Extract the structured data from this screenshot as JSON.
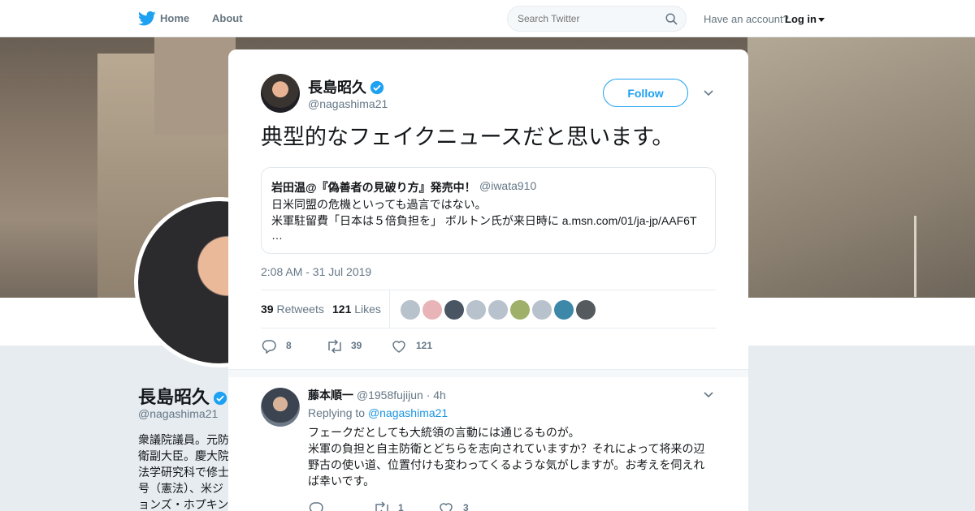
{
  "nav": {
    "home_label": "Home",
    "about_label": "About",
    "search_placeholder": "Search Twitter",
    "have_account": "Have an account?",
    "login_label": "Log in"
  },
  "profile": {
    "name": "長島昭久",
    "handle": "@nagashima21",
    "bio": "衆議院議員。元防衛副大臣。慶大院法学研究科で修士号（憲法）、米ジョンズ・ホプキンス大学SAIS修士（国際関係論）取得。現在、…員、子どもの貧困…"
  },
  "tweet": {
    "author_name": "長島昭久",
    "author_handle": "@nagashima21",
    "follow_label": "Follow",
    "text": "典型的なフェイクニュースだと思います。",
    "timestamp": "2:08 AM - 31 Jul 2019",
    "retweets_count": "39",
    "retweets_label": "Retweets",
    "likes_count": "121",
    "likes_label": "Likes",
    "reply_count": "8",
    "retweet_count": "39",
    "like_count": "121",
    "liker_colors": [
      "#b8c2cc",
      "#e8b4b8",
      "#4a5563",
      "#b8c2cc",
      "#b8c2cc",
      "#9fb06a",
      "#b8c2cc",
      "#3d87a8",
      "#555a5f"
    ]
  },
  "quote": {
    "author_name": "岩田温@『偽善者の見破り方』発売中！",
    "author_handle": "@iwata910",
    "line1": "日米同盟の危機といっても過言ではない。",
    "line2": "米軍駐留費「日本は５倍負担を」 ボルトン氏が来日時に a.msn.com/01/ja-jp/AAF6T",
    "line3": "…"
  },
  "reply": {
    "author_name": "藤本順一",
    "author_handle": "@1958fujijun",
    "time": "· 4h",
    "replying_prefix": "Replying to",
    "replying_to": "@nagashima21",
    "line1": "フェークだとしても大統領の言動には通じるものが。",
    "line2": "米軍の負担と自主防衛とどちらを志向されていますか？それによって将来の辺",
    "line3": "野古の使い道、位置付けも変わってくるような気がしますが。お考えを伺えれ",
    "line4": "ば幸いです。",
    "reply_count": "",
    "retweet_count": "1",
    "like_count": "3"
  },
  "colors": {
    "accent": "#1da1f2",
    "link": "#1b95e0",
    "verified": "#1da1f2"
  }
}
